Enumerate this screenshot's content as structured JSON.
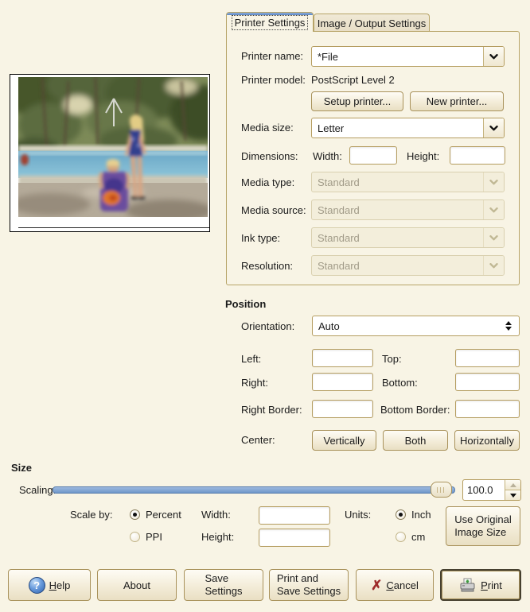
{
  "colors": {
    "bg": "#f8f4e5",
    "panel_border": "#b7a468",
    "accent_blue": "#6f97c9",
    "tab_strip": "#5c88c4",
    "cancel_red": "#9e2b2b",
    "help_blue": "#2f62ad",
    "disabled_text": "#a19b88"
  },
  "icons": {
    "help": "?",
    "cancel": "✗",
    "print": "printer-glyph",
    "combo": "chevron-down",
    "orientation": "up-down-triangles",
    "spin": "up-down-steppers"
  },
  "tabs": [
    {
      "label": "Printer Settings",
      "active": true
    },
    {
      "label": "Image / Output Settings",
      "active": false
    }
  ],
  "printer": {
    "name_label": "Printer name:",
    "name_value": "*File",
    "model_label": "Printer model:",
    "model_value": "PostScript Level 2",
    "setup_button": "Setup printer...",
    "new_button": "New printer...",
    "media_size_label": "Media size:",
    "media_size_value": "Letter",
    "dimensions_label": "Dimensions:",
    "width_label": "Width:",
    "height_label": "Height:",
    "media_type_label": "Media type:",
    "media_type_value": "Standard",
    "media_source_label": "Media source:",
    "media_source_value": "Standard",
    "ink_type_label": "Ink type:",
    "ink_type_value": "Standard",
    "resolution_label": "Resolution:",
    "resolution_value": "Standard"
  },
  "position": {
    "heading": "Position",
    "orientation_label": "Orientation:",
    "orientation_value": "Auto",
    "left_label": "Left:",
    "top_label": "Top:",
    "right_label": "Right:",
    "bottom_label": "Bottom:",
    "right_border_label": "Right Border:",
    "bottom_border_label": "Bottom Border:",
    "center_label": "Center:",
    "center_buttons": [
      "Vertically",
      "Both",
      "Horizontally"
    ]
  },
  "size": {
    "heading": "Size",
    "scaling_label": "Scaling:",
    "scaling_value": "100.0",
    "scale_by_label": "Scale by:",
    "percent_label": "Percent",
    "ppi_label": "PPI",
    "width_label": "Width:",
    "height_label": "Height:",
    "units_label": "Units:",
    "inch_label": "Inch",
    "cm_label": "cm",
    "use_original_button": "Use Original\nImage Size"
  },
  "footer": {
    "help_initial": "H",
    "help_rest": "elp",
    "about": "About",
    "save_settings": "Save\nSettings",
    "print_and_save": "Print and\nSave Settings",
    "cancel_initial": "C",
    "cancel_rest": "ancel",
    "print_initial": "P",
    "print_rest": "rint"
  }
}
